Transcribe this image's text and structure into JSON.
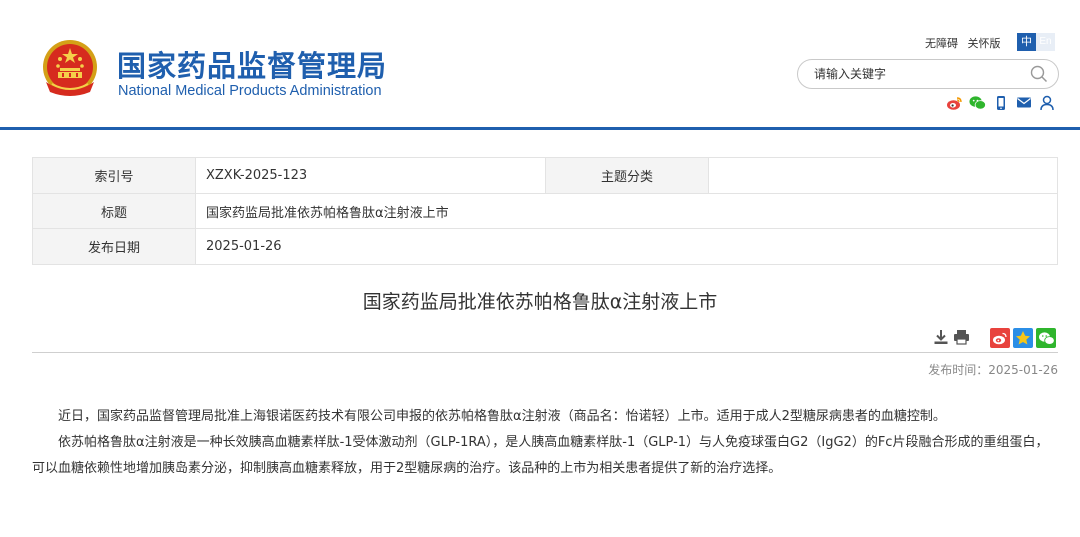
{
  "header": {
    "logo_cn": "国家药品监督管理局",
    "logo_en": "National Medical Products Administration",
    "link_accessible": "无障碍",
    "link_elderly": "关怀版",
    "lang_zh": "中",
    "lang_en": "En",
    "search_placeholder": "请输入关键字",
    "social_icons": [
      "weibo-icon",
      "wechat-icon",
      "mobile-icon",
      "mail-icon",
      "user-icon"
    ]
  },
  "info": {
    "index_label": "索引号",
    "index_value": "XZXK-2025-123",
    "category_label": "主题分类",
    "category_value": "",
    "title_label": "标题",
    "title_value": "国家药监局批准依苏帕格鲁肽α注射液上市",
    "date_label": "发布日期",
    "date_value": "2025-01-26"
  },
  "article": {
    "title": "国家药监局批准依苏帕格鲁肽α注射液上市",
    "pubtime_label": "发布时间：",
    "pubtime_value": "2025-01-26",
    "paragraphs": [
      "近日，国家药品监督管理局批准上海银诺医药技术有限公司申报的依苏帕格鲁肽α注射液（商品名：怡诺轻）上市。适用于成人2型糖尿病患者的血糖控制。",
      "依苏帕格鲁肽α注射液是一种长效胰高血糖素样肽-1受体激动剂（GLP-1RA），是人胰高血糖素样肽-1（GLP-1）与人免疫球蛋白G2（IgG2）的Fc片段融合形成的重组蛋白，可以血糖依赖性地增加胰岛素分泌，抑制胰高血糖素释放，用于2型糖尿病的治疗。该品种的上市为相关患者提供了新的治疗选择。"
    ],
    "tool_icons": [
      "download-icon",
      "print-icon"
    ],
    "share_icons": [
      "weibo-share-icon",
      "qzone-share-icon",
      "wechat-share-icon"
    ]
  },
  "colors": {
    "brand_blue": "#1f5fae",
    "label_bg": "#f4f4f4",
    "weibo_red": "#e8423d",
    "qzone_blue": "#2b8ee6",
    "wechat_green": "#2fb52d"
  }
}
